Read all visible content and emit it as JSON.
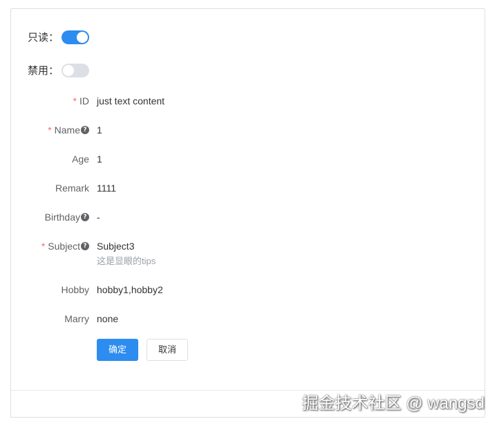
{
  "toggles": {
    "readonly": {
      "label": "只读：",
      "state": "on"
    },
    "disabled": {
      "label": "禁用：",
      "state": "off"
    }
  },
  "form": {
    "id": {
      "label": "ID",
      "value": "just text content",
      "required": true
    },
    "name": {
      "label": "Name",
      "value": "1",
      "required": true,
      "help": true
    },
    "age": {
      "label": "Age",
      "value": "1"
    },
    "remark": {
      "label": "Remark",
      "value": "1111"
    },
    "birthday": {
      "label": "Birthday",
      "value": "-",
      "help": true
    },
    "subject": {
      "label": "Subject",
      "value": "Subject3",
      "required": true,
      "help": true,
      "tips": "这是显眼的tips"
    },
    "hobby": {
      "label": "Hobby",
      "value": "hobby1,hobby2"
    },
    "marry": {
      "label": "Marry",
      "value": "none"
    }
  },
  "actions": {
    "confirm_label": "确定",
    "cancel_label": "取消"
  },
  "symbols": {
    "required_mark": "*",
    "help_glyph": "?"
  },
  "watermark": "掘金技术社区 @ wangsd",
  "colors": {
    "primary": "#2d8cf0",
    "required": "#f56c6c",
    "switch_off": "#dcdfe6"
  }
}
